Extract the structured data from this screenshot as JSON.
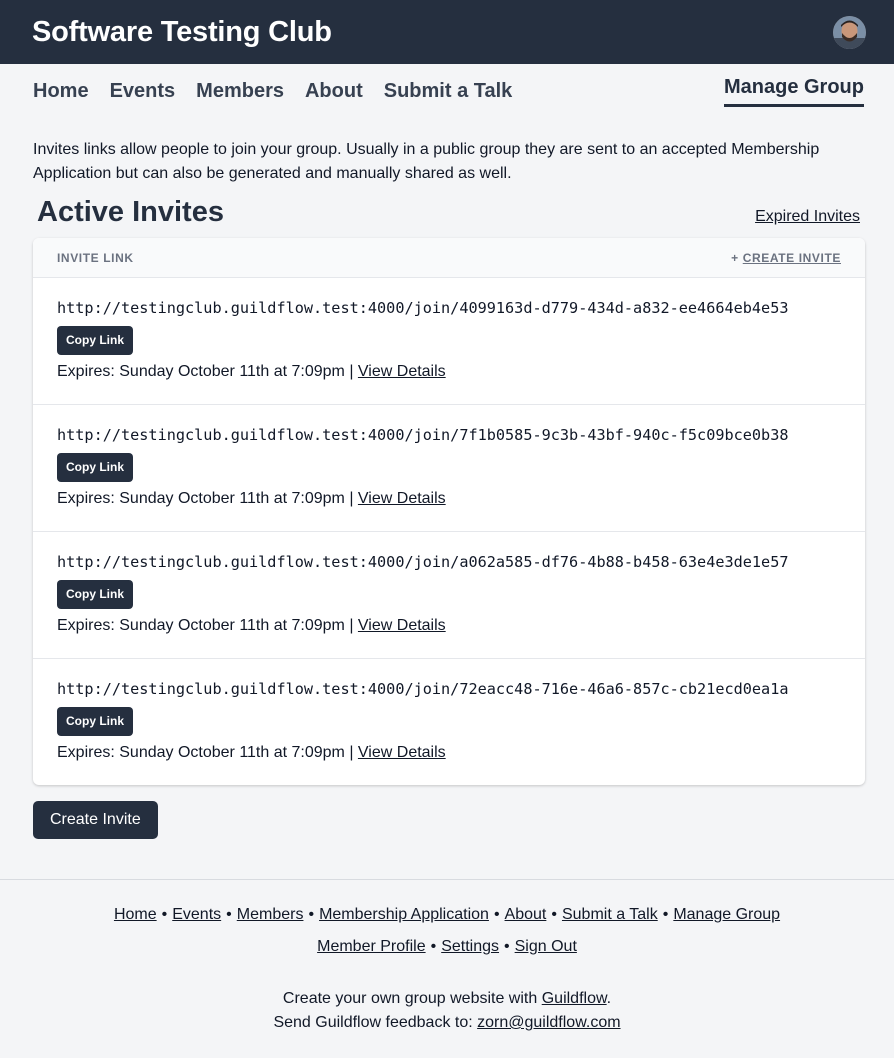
{
  "header": {
    "title": "Software Testing Club"
  },
  "nav": {
    "items": [
      "Home",
      "Events",
      "Members",
      "About",
      "Submit a Talk"
    ],
    "active": "Manage Group"
  },
  "intro": "Invites links allow people to join your group. Usually in a public group they are sent to an accepted Membership Application but can also be generated and manually shared as well.",
  "section": {
    "title": "Active Invites",
    "expired_link": "Expired Invites"
  },
  "table": {
    "column_label": "INVITE LINK",
    "create_plus": "+",
    "create_label": "CREATE INVITE",
    "copy_label": "Copy Link",
    "details_label": "View Details",
    "rows": [
      {
        "url": "http://testingclub.guildflow.test:4000/join/4099163d-d779-434d-a832-ee4664eb4e53",
        "expires": "Expires: Sunday October 11th at 7:09pm |"
      },
      {
        "url": "http://testingclub.guildflow.test:4000/join/7f1b0585-9c3b-43bf-940c-f5c09bce0b38",
        "expires": "Expires: Sunday October 11th at 7:09pm |"
      },
      {
        "url": "http://testingclub.guildflow.test:4000/join/a062a585-df76-4b88-b458-63e4e3de1e57",
        "expires": "Expires: Sunday October 11th at 7:09pm |"
      },
      {
        "url": "http://testingclub.guildflow.test:4000/join/72eacc48-716e-46a6-857c-cb21ecd0ea1a",
        "expires": "Expires: Sunday October 11th at 7:09pm |"
      }
    ]
  },
  "create_button": "Create Invite",
  "footer": {
    "line1": [
      "Home",
      "Events",
      "Members",
      "Membership Application",
      "About",
      "Submit a Talk",
      "Manage Group"
    ],
    "line2": [
      "Member Profile",
      "Settings",
      "Sign Out"
    ],
    "separator": "•",
    "credit_prefix": "Create your own group website with",
    "credit_link": "Guildflow",
    "credit_suffix": ".",
    "feedback_prefix": "Send Guildflow feedback to:",
    "feedback_email": "zorn@guildflow.com"
  },
  "colors": {
    "header_bg": "#252f3f",
    "page_bg": "#f4f5f7",
    "button_bg": "#252f3f"
  }
}
